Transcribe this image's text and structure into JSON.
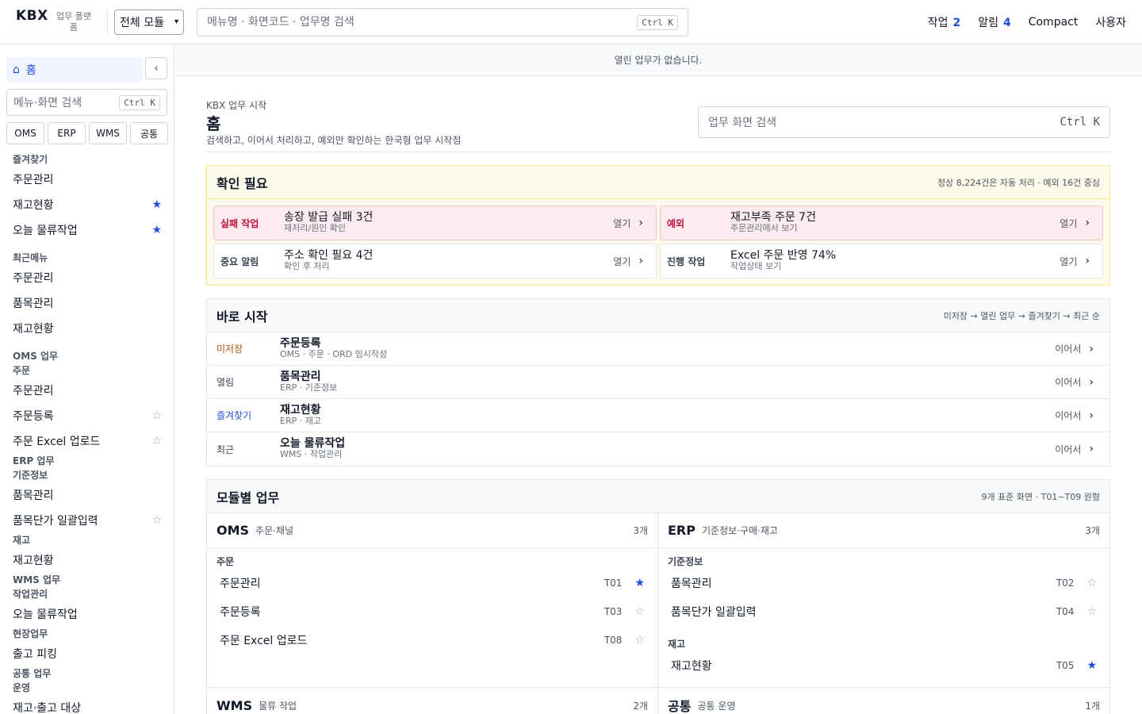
{
  "topbar": {
    "logo": "KBX",
    "logo_sub": "업무 플랫폼",
    "module_select": "전체 모듈",
    "search_placeholder": "메뉴명 · 화면코드 · 업무명 검색",
    "search_shortcut": "Ctrl K",
    "nav": [
      {
        "label": "작업",
        "count": "2"
      },
      {
        "label": "알림",
        "count": "4"
      },
      {
        "label": "Compact"
      },
      {
        "label": "사용자"
      }
    ]
  },
  "sidebar": {
    "home_label": "홈",
    "collapse_label": "‹",
    "search_placeholder": "메뉴·화면 검색",
    "search_shortcut": "Ctrl K",
    "module_tabs": [
      "OMS",
      "ERP",
      "WMS",
      "공통"
    ],
    "favorites_head": "즐겨찾기",
    "favorites": [
      {
        "label": "주문관리",
        "star": ""
      },
      {
        "label": "재고현황",
        "star": "★"
      },
      {
        "label": "오늘 물류작업",
        "star": "★"
      }
    ],
    "recent_head": "최근메뉴",
    "recent": [
      "주문관리",
      "품목관리",
      "재고현황"
    ],
    "oms_head": "OMS 업무",
    "oms_group": "주문",
    "oms_items": [
      {
        "label": "주문관리",
        "star": ""
      },
      {
        "label": "주문등록",
        "star": "☆"
      },
      {
        "label": "주문 Excel 업로드",
        "star": "☆"
      }
    ],
    "erp_head": "ERP 업무",
    "erp_group1": "기준정보",
    "erp_items1": [
      {
        "label": "품목관리",
        "star": ""
      },
      {
        "label": "품목단가 일괄입력",
        "star": "☆"
      }
    ],
    "erp_group2": "재고",
    "erp_items2": [
      {
        "label": "재고현황",
        "star": ""
      }
    ],
    "wms_head": "WMS 업무",
    "wms_group1": "작업관리",
    "wms_items1": [
      {
        "label": "오늘 물류작업",
        "star": ""
      }
    ],
    "wms_group2": "현장업무",
    "wms_items2": [
      {
        "label": "출고 피킹",
        "star": ""
      }
    ],
    "common_head": "공통 업무",
    "common_group": "운영",
    "common_items": [
      {
        "label": "재고·출고 대상",
        "star": ""
      }
    ]
  },
  "main": {
    "tabbar_empty": "열린 업무가 없습니다.",
    "hero": {
      "kicker": "KBX 업무 시작",
      "title": "홈",
      "desc": "검색하고, 이어서 처리하고, 예외만 확인하는 한국형 업무 시작점",
      "search_placeholder": "업무 화면 검색",
      "search_shortcut": "Ctrl K"
    },
    "attention": {
      "title": "확인 필요",
      "meta": "정상 8,224건은 자동 처리 · 예외 16건 중심",
      "open_label": "열기",
      "cards": [
        {
          "tag": "실패 작업",
          "title": "송장 발급 실패 3건",
          "sub": "재처리/원인 확인"
        },
        {
          "tag": "예외",
          "title": "재고부족 주문 7건",
          "sub": "주문관리에서 보기"
        },
        {
          "tag": "중요 알림",
          "title": "주소 확인 필요 4건",
          "sub": "확인 후 처리"
        },
        {
          "tag": "진행 작업",
          "title": "Excel 주문 반영 74%",
          "sub": "작업상태 보기"
        }
      ]
    },
    "quick": {
      "title": "바로 시작",
      "meta": "미저장 → 열린 업무 → 즐겨찾기 → 최근 순",
      "go_label": "이어서",
      "rows": [
        {
          "tag": "미저장",
          "title": "주문등록",
          "sub": "OMS · 주문 · ORD 임시작성"
        },
        {
          "tag": "열림",
          "title": "품목관리",
          "sub": "ERP · 기준정보"
        },
        {
          "tag": "즐겨찾기",
          "title": "재고현황",
          "sub": "ERP · 재고"
        },
        {
          "tag": "최근",
          "title": "오늘 물류작업",
          "sub": "WMS · 작업관리"
        }
      ]
    },
    "modules": {
      "title": "모듈별 업무",
      "meta": "9개 표준 화면 · T01~T09 원형",
      "oms": {
        "name": "OMS",
        "desc": "주문·채널",
        "count": "3개",
        "group": "주문",
        "items": [
          {
            "name": "주문관리",
            "code": "T01",
            "star": "★"
          },
          {
            "name": "주문등록",
            "code": "T03",
            "star": "☆"
          },
          {
            "name": "주문 Excel 업로드",
            "code": "T08",
            "star": "☆"
          }
        ]
      },
      "erp": {
        "name": "ERP",
        "desc": "기준정보·구매·재고",
        "count": "3개",
        "group1": "기준정보",
        "items1": [
          {
            "name": "품목관리",
            "code": "T02",
            "star": "☆"
          },
          {
            "name": "품목단가 일괄입력",
            "code": "T04",
            "star": "☆"
          }
        ],
        "group2": "재고",
        "items2": [
          {
            "name": "재고현황",
            "code": "T05",
            "star": "★"
          }
        ]
      },
      "wms": {
        "name": "WMS",
        "desc": "물류 작업",
        "count": "2개"
      },
      "common": {
        "name": "공통",
        "desc": "공통 운영",
        "count": "1개"
      }
    }
  }
}
